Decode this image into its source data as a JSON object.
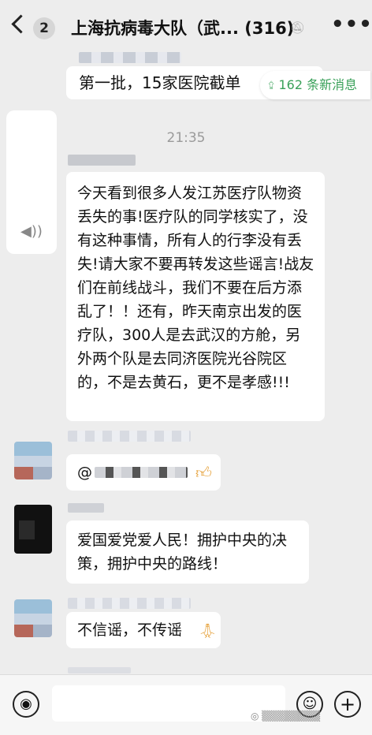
{
  "header": {
    "badge": "2",
    "title": "上海抗病毒大队（武... (316)",
    "mute_icon": "mute-icon",
    "more_label": "•••"
  },
  "new_messages": {
    "label": "162 条新消息",
    "icon": "double-chevron-up-icon",
    "accent": "#3aa15a"
  },
  "messages": [
    {
      "text": "第一批，15家医院截单"
    },
    {
      "time": "21:35"
    },
    {
      "text": "今天看到很多人发江苏医疗队物资丢失的事!医疗队的同学核实了，没有这种事情，所有人的行李没有丢失!请大家不要再转发这些谣言!战友们在前线战斗，我们不要在后方添乱了！！还有，昨天南京出发的医疗队，300人是去武汉的方舱，另外两个队是去同济医院光谷院区的，不是去黄石，更不是孝感!!!"
    },
    {
      "text": "@"
    },
    {
      "text": "爱国爱党爱人民！拥护中央的决策，拥护中央的路线！"
    },
    {
      "text": "不信谣，不传谣"
    }
  ],
  "bottom": {
    "voice_icon": "voice-icon",
    "emoji_icon": "emoji-icon",
    "plus_icon": "plus-icon"
  }
}
